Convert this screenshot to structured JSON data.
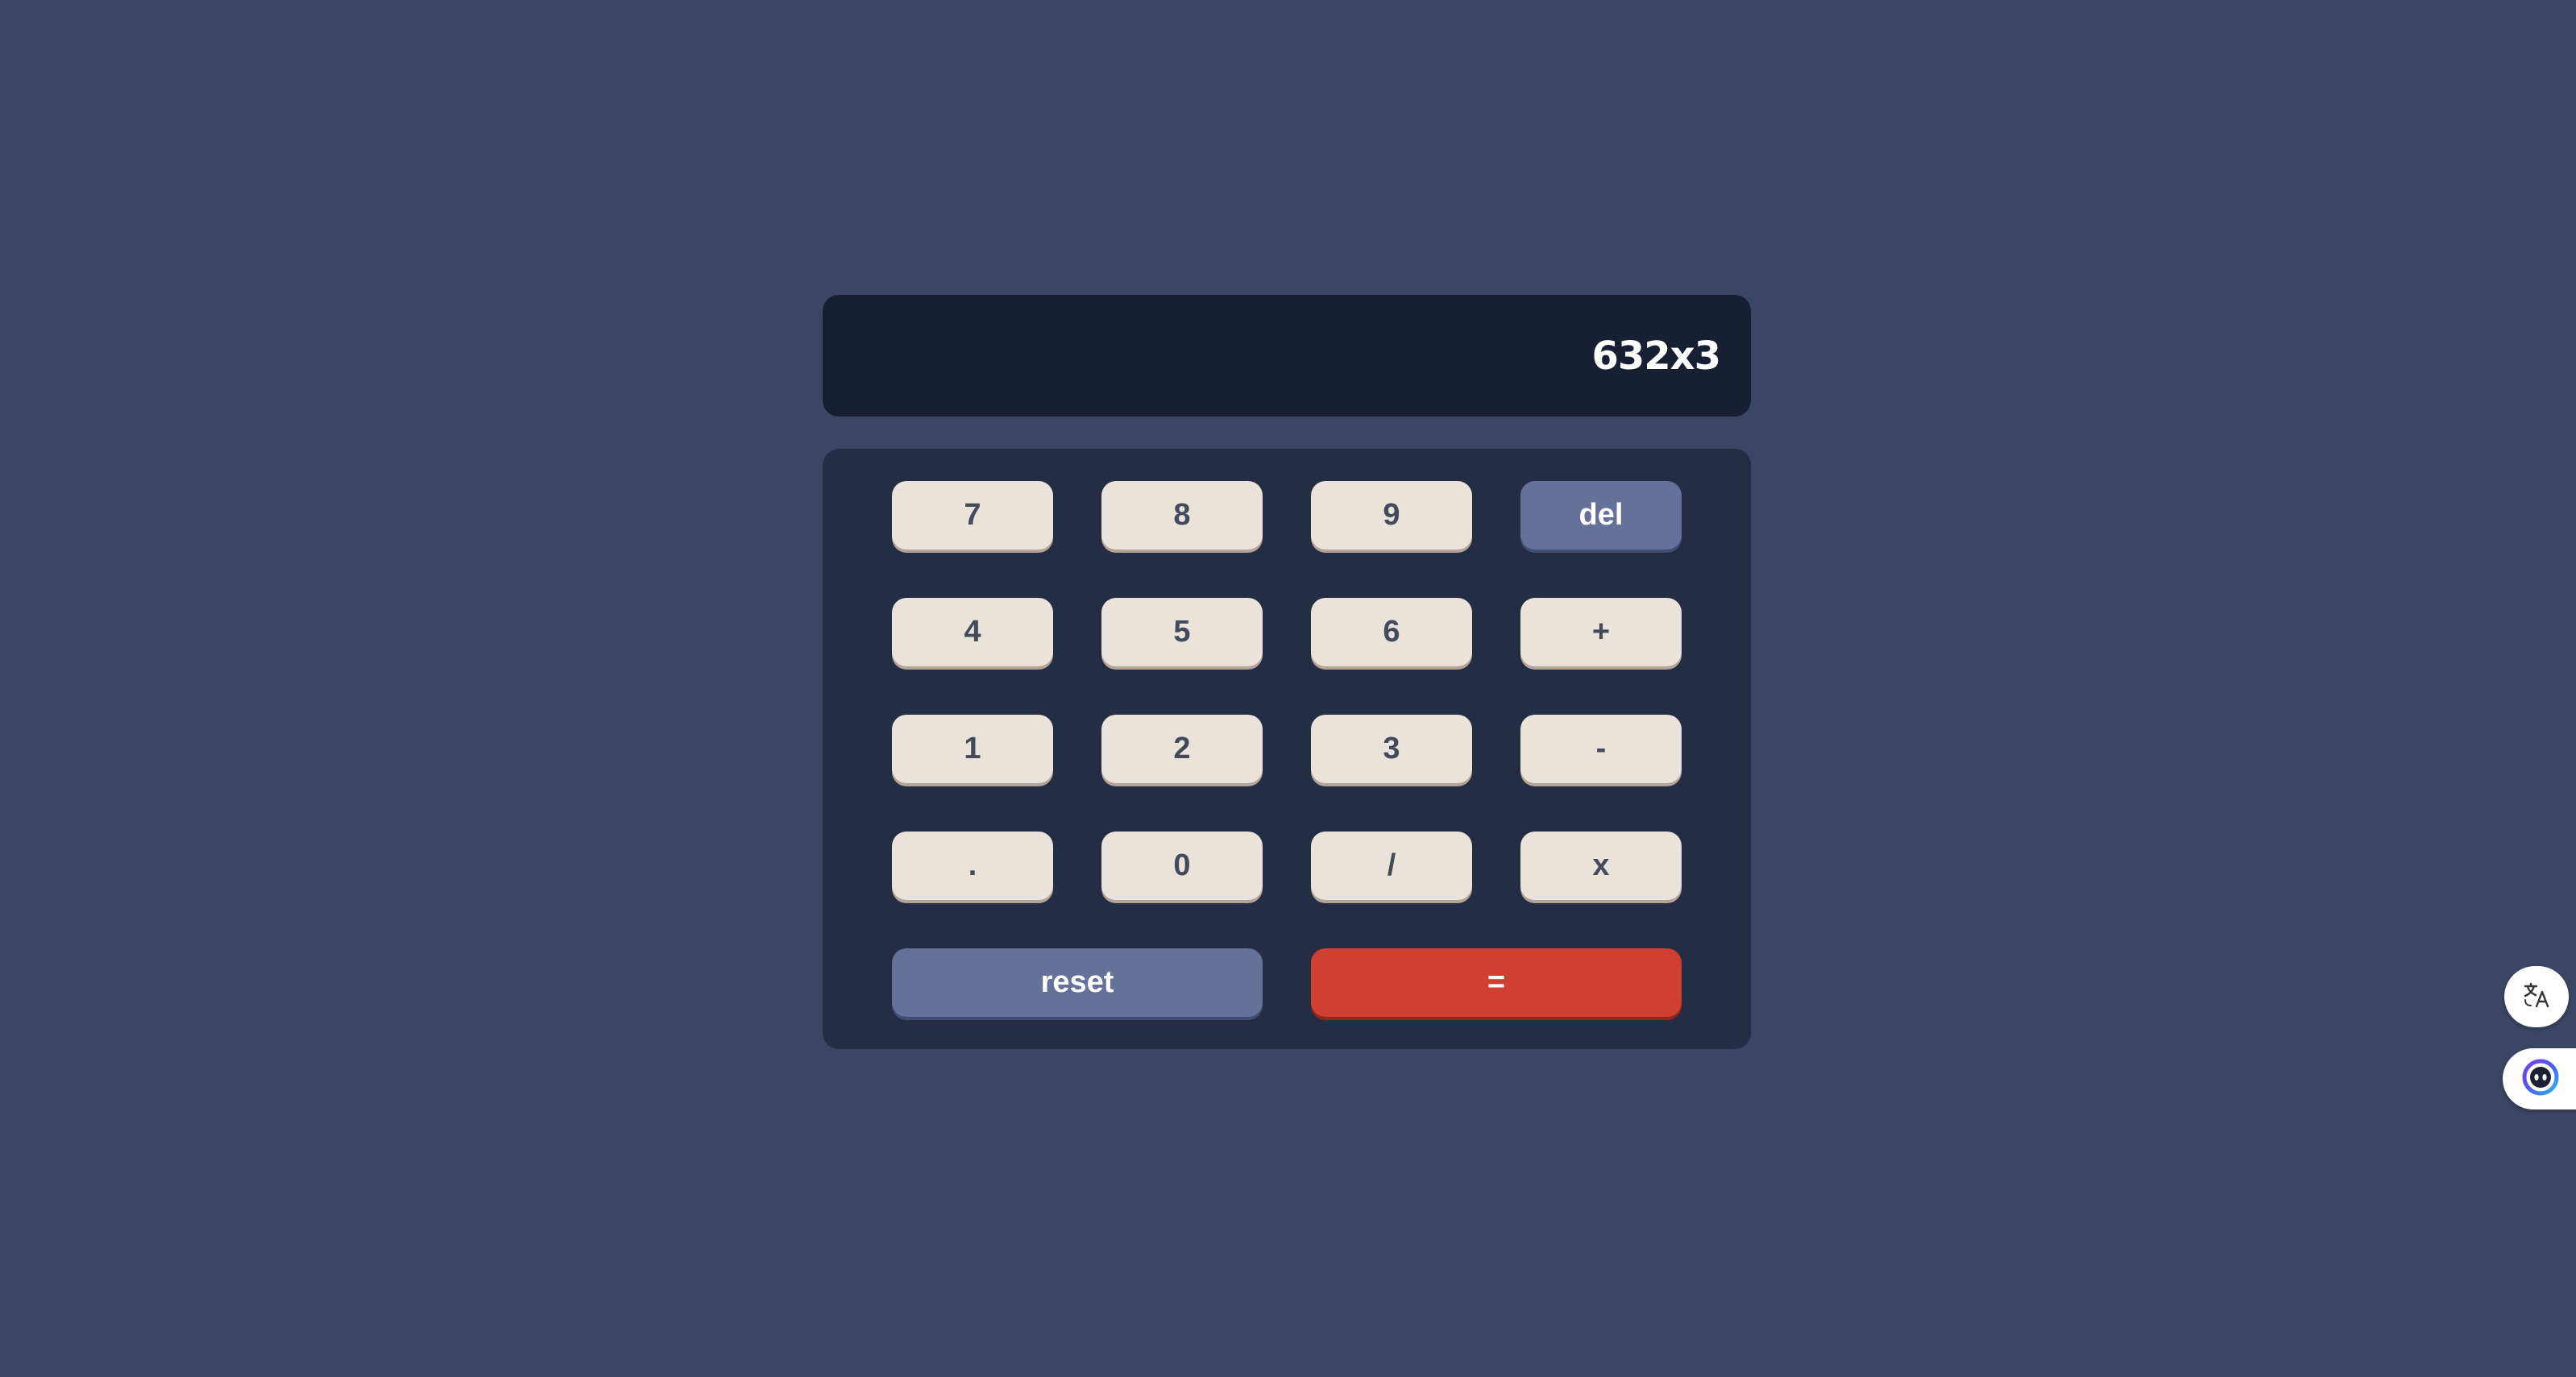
{
  "display": {
    "value": "632x3"
  },
  "keys": {
    "k7": "7",
    "k8": "8",
    "k9": "9",
    "del": "del",
    "k4": "4",
    "k5": "5",
    "k6": "6",
    "plus": "+",
    "k1": "1",
    "k2": "2",
    "k3": "3",
    "minus": "-",
    "dot": ".",
    "k0": "0",
    "divide": "/",
    "multiply": "x",
    "reset": "reset",
    "equals": "="
  },
  "colors": {
    "background": "#3b4664",
    "display_background": "#181f32",
    "keypad_background": "#242d44",
    "key": "#eae3dc",
    "key_text": "#434a59",
    "accent_blue": "#647299",
    "accent_red": "#d03f2f"
  },
  "side_buttons": {
    "translate_icon": "translate-icon",
    "assistant_icon": "assistant-face-icon"
  }
}
